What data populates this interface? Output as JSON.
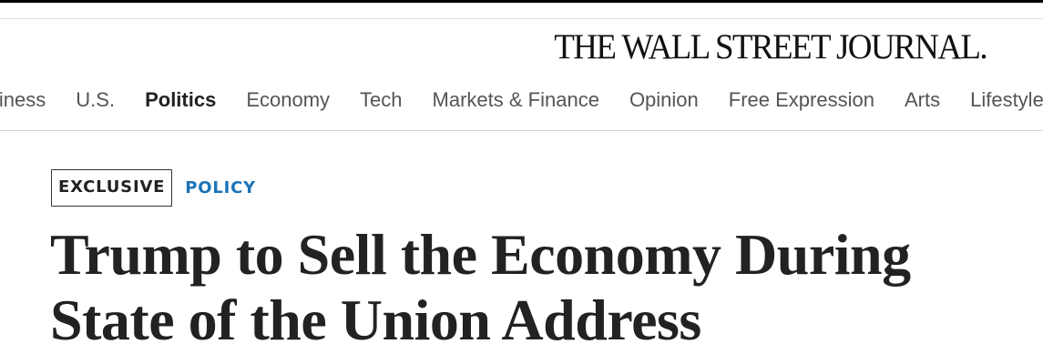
{
  "masthead": {
    "title": "THE WALL STREET JOURNAL."
  },
  "nav": {
    "items": [
      {
        "label": "Business"
      },
      {
        "label": "U.S."
      },
      {
        "label": "Politics",
        "active": true
      },
      {
        "label": "Economy"
      },
      {
        "label": "Tech"
      },
      {
        "label": "Markets & Finance"
      },
      {
        "label": "Opinion"
      },
      {
        "label": "Free Expression"
      },
      {
        "label": "Arts"
      },
      {
        "label": "Lifestyle"
      }
    ]
  },
  "article": {
    "badge": "EXCLUSIVE",
    "category": "POLICY",
    "headline": "Trump to Sell the Economy During State of the Union Address"
  },
  "colors": {
    "category": "#1a73b8",
    "text": "#222222",
    "nav_text": "#555555"
  }
}
